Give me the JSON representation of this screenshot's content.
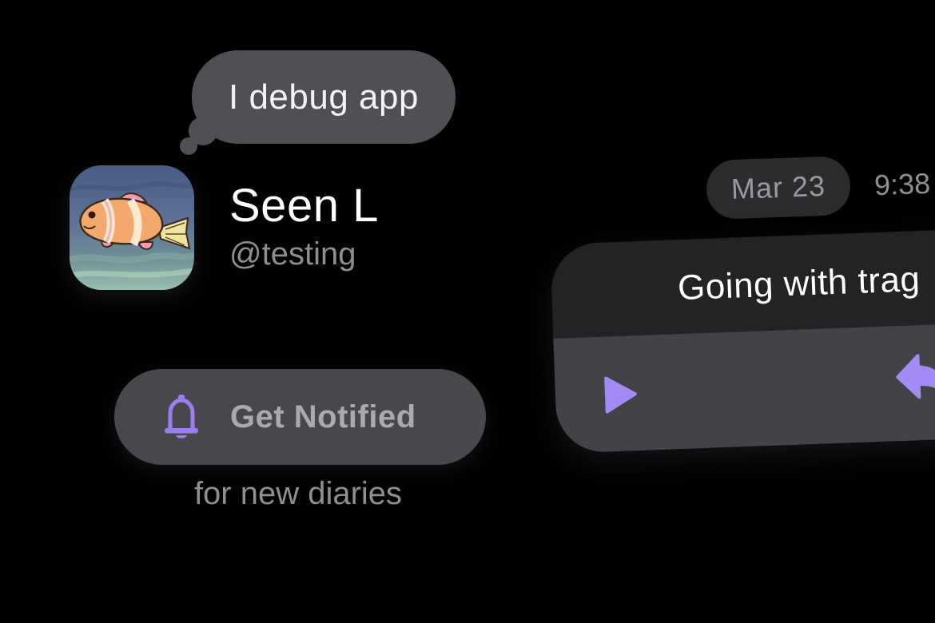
{
  "status": {
    "text": "I debug app"
  },
  "profile": {
    "display_name": "Seen L",
    "handle": "@testing",
    "avatar_icon": "clownfish-avatar"
  },
  "notify": {
    "label": "Get Notified",
    "caption": "for new diaries",
    "icon": "bell-icon",
    "icon_color": "#9b7ff0"
  },
  "diary": {
    "date": "Mar 23",
    "time": "9:38",
    "title": "Going with trag",
    "play_icon": "play-icon",
    "reply_icon": "reply-icon",
    "accent_color": "#a48af5"
  },
  "colors": {
    "background": "#000000",
    "bubble": "#505054",
    "button": "#48484c",
    "card": "#232326",
    "card_controls": "#434347"
  }
}
